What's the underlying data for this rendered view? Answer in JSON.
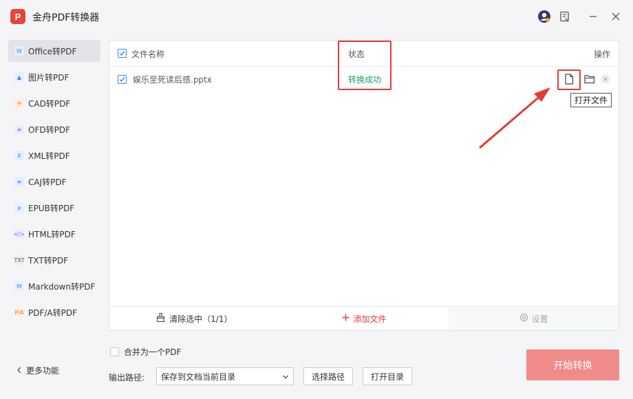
{
  "app": {
    "title": "金舟PDF转换器",
    "logo_text": "P"
  },
  "sidebar": {
    "items": [
      {
        "label": "Office转PDF",
        "icon": "word-icon",
        "glyph": "W",
        "color": "#3b82f6",
        "bg": "#e4efff"
      },
      {
        "label": "图片转PDF",
        "icon": "image-icon",
        "glyph": "▲",
        "color": "#3b82f6",
        "bg": "#e4efff"
      },
      {
        "label": "CAD转PDF",
        "icon": "cad-icon",
        "glyph": "✛",
        "color": "#f97316",
        "bg": "#fff0e5"
      },
      {
        "label": "OFD转PDF",
        "icon": "ofd-icon",
        "glyph": "≡",
        "color": "#8b5cf6",
        "bg": "#f0eaff"
      },
      {
        "label": "XML转PDF",
        "icon": "xml-icon",
        "glyph": "X",
        "color": "#3b82f6",
        "bg": "#e4efff"
      },
      {
        "label": "CAJ转PDF",
        "icon": "caj-icon",
        "glyph": "≡",
        "color": "#3b82f6",
        "bg": "#e4efff"
      },
      {
        "label": "EPUB转PDF",
        "icon": "epub-icon",
        "glyph": "e",
        "color": "#3b82f6",
        "bg": "#e4efff"
      },
      {
        "label": "HTML转PDF",
        "icon": "html-icon",
        "glyph": "</>",
        "color": "#8b5cf6",
        "bg": "#f0eaff"
      },
      {
        "label": "TXT转PDF",
        "icon": "txt-icon",
        "glyph": "TXT",
        "color": "#555555",
        "bg": "#eeeeee"
      },
      {
        "label": "Markdown转PDF",
        "icon": "markdown-icon",
        "glyph": "M",
        "color": "#3b82f6",
        "bg": "#e4efff"
      },
      {
        "label": "PDF/A转PDF",
        "icon": "pdfa-icon",
        "glyph": "P/A",
        "color": "#f97316",
        "bg": "#fff0e5"
      }
    ],
    "more_label": "更多功能"
  },
  "table": {
    "col_name": "文件名称",
    "col_status": "状态",
    "col_ops": "操作",
    "rows": [
      {
        "name": "娱乐至死读后感.pptx",
        "status": "转换成功"
      }
    ],
    "tooltip": "打开文件"
  },
  "footer": {
    "clear_label": "清除选中（1/1）",
    "add_label": "添加文件",
    "settings_label": "设置"
  },
  "bottom": {
    "merge_label": "合并为一个PDF",
    "output_label": "输出路径:",
    "output_value": "保存到文档当前目录",
    "choose_path": "选择路径",
    "open_dir": "打开目录",
    "start": "开始转换"
  },
  "colors": {
    "accent": "#3b82f6",
    "success": "#22a05a",
    "danger": "#e53935",
    "start_btn": "#ef8b88"
  }
}
